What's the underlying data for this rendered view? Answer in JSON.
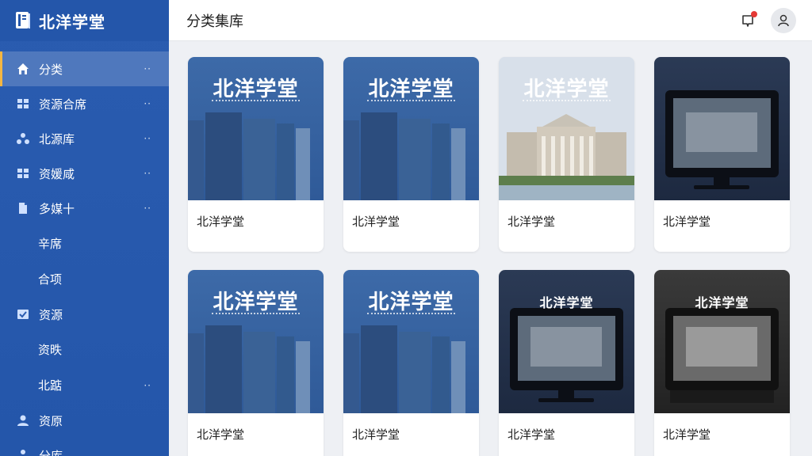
{
  "app": {
    "title": "北洋学堂"
  },
  "header": {
    "title": "分类集库"
  },
  "colors": {
    "sidebar": "#2a5cb0",
    "accent": "#f5b641",
    "badge": "#e53935"
  },
  "sidebar": {
    "items": [
      {
        "label": "分类",
        "icon": "home-icon",
        "active": true,
        "dots": "··"
      },
      {
        "label": "资源合席",
        "icon": "grid-icon",
        "dots": "··"
      },
      {
        "label": "北源库",
        "icon": "cluster-icon",
        "dots": "··"
      },
      {
        "label": "资媛咸",
        "icon": "grid-icon",
        "dots": "··"
      },
      {
        "label": "多媒十",
        "icon": "document-icon",
        "dots": "··"
      },
      {
        "label": "辛席",
        "sub": true
      },
      {
        "label": "合项",
        "sub": true
      },
      {
        "label": "资源",
        "icon": "checklist-icon"
      },
      {
        "label": "资昳",
        "sub": true
      },
      {
        "label": "北踮",
        "sub": true,
        "dots": "··"
      },
      {
        "label": "资原",
        "icon": "users-icon"
      },
      {
        "label": "分库",
        "icon": "cluster-icon"
      }
    ]
  },
  "cards": [
    {
      "label": "北洋学堂",
      "thumb_type": "books",
      "thumb_text": "北洋学堂"
    },
    {
      "label": "北洋学堂",
      "thumb_type": "books",
      "thumb_text": "北洋学堂"
    },
    {
      "label": "北洋学堂",
      "thumb_type": "building",
      "thumb_text": "北洋学堂"
    },
    {
      "label": "北洋学堂",
      "thumb_type": "monitor",
      "thumb_text": ""
    },
    {
      "label": "北洋学堂",
      "thumb_type": "books",
      "thumb_text": "北洋学堂"
    },
    {
      "label": "北洋学堂",
      "thumb_type": "books",
      "thumb_text": "北洋学堂"
    },
    {
      "label": "北洋学堂",
      "thumb_type": "monitor",
      "thumb_text": "北洋学堂"
    },
    {
      "label": "北洋学堂",
      "thumb_type": "monitor-dark",
      "thumb_text": "北洋学堂"
    }
  ]
}
